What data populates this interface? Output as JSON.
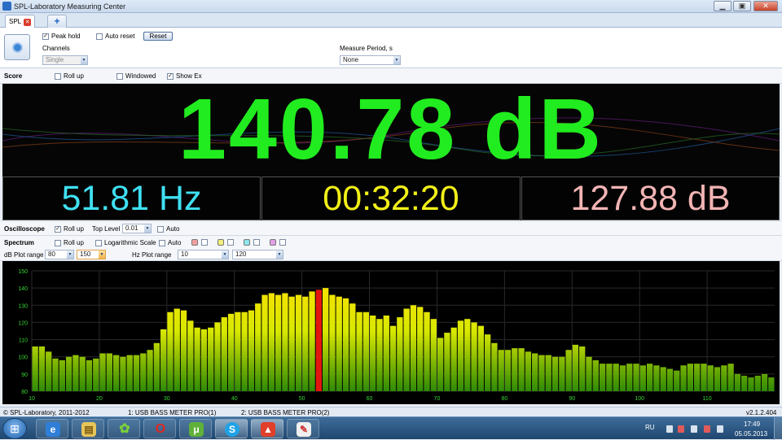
{
  "window": {
    "title": "SPL-Laboratory Measuring Center",
    "minimize": "▁",
    "maximize": "▣",
    "close": "✕"
  },
  "tabs": [
    {
      "label": "SPL",
      "close": "✕"
    },
    {
      "label": "+"
    }
  ],
  "controls": {
    "peak_hold": {
      "label": "Peak hold",
      "checked": "✓"
    },
    "auto_reset": {
      "label": "Auto reset"
    },
    "reset_button": "Reset",
    "channels_label": "Channels",
    "channels_value": "Single",
    "measure_period_label": "Measure Period, s",
    "measure_period_value": "None"
  },
  "score": {
    "label": "Score",
    "roll_up": "Roll up",
    "windowed": "Windowed",
    "show_ex": "Show Ex",
    "show_ex_checked": "✓"
  },
  "readouts": {
    "main": "140.78 dB",
    "frequency": "51.81 Hz",
    "time": "00:32:20",
    "secondary_level": "127.88 dB",
    "colors": {
      "main": "#21ec1f",
      "frequency": "#3fe0f2",
      "time": "#f2f018",
      "secondary_level": "#f2b4b4"
    }
  },
  "oscilloscope": {
    "label": "Oscilloscope",
    "roll_up": "Roll up",
    "roll_up_checked": "✓",
    "top_level_label": "Top Level",
    "top_level_value": "0.01",
    "auto": "Auto"
  },
  "spectrum": {
    "label": "Spectrum",
    "roll_up": "Roll up",
    "log_scale": "Logarithmic Scale",
    "auto": "Auto",
    "db_plot_range_label": "dB Plot range",
    "db_min": "80",
    "db_max": "150",
    "hz_plot_range_label": "Hz Plot range",
    "hz_min": "10",
    "hz_max": "120",
    "swatch_colors": [
      "#f0a0a0",
      "#f2f07a",
      "#8ee6ee",
      "#e3a0e8"
    ]
  },
  "chart_data": {
    "type": "bar",
    "xlim": [
      10,
      120
    ],
    "ylim": [
      80,
      150
    ],
    "x_ticks": [
      10,
      20,
      30,
      40,
      50,
      60,
      70,
      80,
      90,
      100,
      110
    ],
    "y_ticks": [
      80,
      90,
      100,
      110,
      120,
      130,
      140,
      150
    ],
    "grid": true,
    "peak_marker_x": 52,
    "x": [
      10,
      11,
      12,
      13,
      14,
      15,
      16,
      17,
      18,
      19,
      20,
      21,
      22,
      23,
      24,
      25,
      26,
      27,
      28,
      29,
      30,
      31,
      32,
      33,
      34,
      35,
      36,
      37,
      38,
      39,
      40,
      41,
      42,
      43,
      44,
      45,
      46,
      47,
      48,
      49,
      50,
      51,
      52,
      53,
      54,
      55,
      56,
      57,
      58,
      59,
      60,
      61,
      62,
      63,
      64,
      65,
      66,
      67,
      68,
      69,
      70,
      71,
      72,
      73,
      74,
      75,
      76,
      77,
      78,
      79,
      80,
      81,
      82,
      83,
      84,
      85,
      86,
      87,
      88,
      89,
      90,
      91,
      92,
      93,
      94,
      95,
      96,
      97,
      98,
      99,
      100,
      101,
      102,
      103,
      104,
      105,
      106,
      107,
      108,
      109,
      110,
      111,
      112,
      113,
      114,
      115,
      116,
      117,
      118,
      119
    ],
    "values": [
      106,
      106,
      103,
      99,
      98,
      100,
      101,
      100,
      98,
      99,
      102,
      102,
      101,
      100,
      101,
      101,
      102,
      104,
      108,
      116,
      126,
      128,
      127,
      121,
      117,
      116,
      117,
      120,
      123,
      125,
      126,
      126,
      127,
      131,
      136,
      137,
      136,
      137,
      135,
      136,
      135,
      138,
      139,
      140,
      136,
      135,
      134,
      131,
      126,
      126,
      124,
      122,
      124,
      118,
      123,
      128,
      130,
      129,
      126,
      122,
      111,
      114,
      117,
      121,
      122,
      120,
      118,
      113,
      108,
      104,
      104,
      105,
      105,
      103,
      102,
      101,
      101,
      100,
      100,
      104,
      107,
      106,
      100,
      98,
      96,
      96,
      96,
      95,
      96,
      96,
      95,
      96,
      95,
      94,
      93,
      92,
      95,
      96,
      96,
      96,
      95,
      94,
      95,
      96,
      90,
      89,
      88,
      89,
      90,
      88
    ]
  },
  "statusbar": {
    "copyright": "© SPL-Laboratory, 2011-2012",
    "device1": "1: USB BASS METER PRO(1)",
    "device2": "2: USB BASS METER PRO(2)",
    "version": "v2.1.2.404"
  },
  "taskbar": {
    "language": "RU",
    "time": "17:49",
    "date": "05.05.2013",
    "items": [
      "ie-icon",
      "explorer-icon",
      "icq-icon",
      "opera-icon",
      "utorrent-icon",
      "skype-icon",
      "spl-meter-icon",
      "paint-icon"
    ]
  }
}
